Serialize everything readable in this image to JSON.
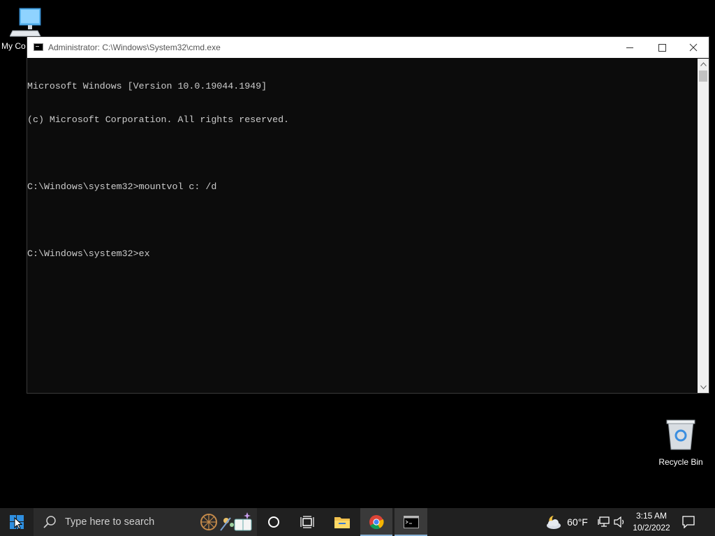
{
  "desktop": {
    "my_computer_label": "My Co",
    "recycle_bin_label": "Recycle Bin"
  },
  "window": {
    "title": "Administrator: C:\\Windows\\System32\\cmd.exe",
    "console_lines": [
      "Microsoft Windows [Version 10.0.19044.1949]",
      "(c) Microsoft Corporation. All rights reserved.",
      "",
      "C:\\Windows\\system32>mountvol c: /d",
      "",
      "C:\\Windows\\system32>ex"
    ],
    "console_text_color": "#cccccc",
    "console_bg": "#0c0c0c"
  },
  "taskbar": {
    "search_placeholder": "Type here to search",
    "weather_temp": "60°F",
    "time": "3:15 AM",
    "date": "10/2/2022",
    "pinned": [
      "cortana-icon",
      "task-view-icon",
      "file-explorer-icon",
      "chrome-icon",
      "command-prompt-icon"
    ],
    "accent": "#0078d7"
  }
}
